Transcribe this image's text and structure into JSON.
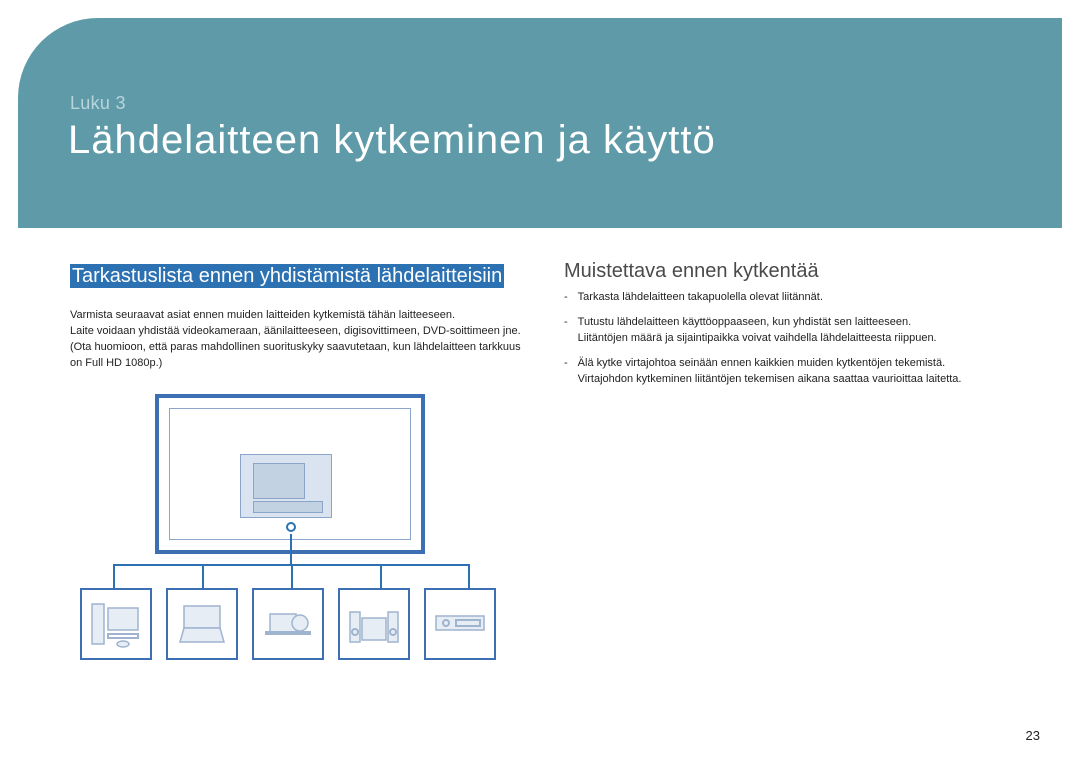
{
  "header": {
    "chapter": "Luku 3",
    "title": "Lähdelaitteen kytkeminen ja käyttö"
  },
  "left": {
    "section_title": "Tarkastuslista ennen yhdistämistä lähdelaitteisiin",
    "intro": "Varmista seuraavat asiat ennen muiden laitteiden kytkemistä tähän laitteeseen.\nLaite voidaan yhdistää videokameraan, äänilaitteeseen, digisovittimeen, DVD-soittimeen jne.\n(Ota huomioon, että paras mahdollinen suorituskyky saavutetaan, kun lähdelaitteen tarkkuus on Full HD 1080p.)"
  },
  "right": {
    "section_title": "Muistettava ennen kytkentää",
    "items": [
      "Tarkasta lähdelaitteen takapuolella olevat liitännät.",
      "Tutustu lähdelaitteen käyttöoppaaseen, kun yhdistät sen laitteeseen.\nLiitäntöjen määrä ja sijaintipaikka voivat vaihdella lähdelaitteesta riippuen.",
      "Älä kytke virtajohtoa seinään ennen kaikkien muiden kytkentöjen tekemistä.\nVirtajohdon kytkeminen liitäntöjen tekemisen aikana saattaa vaurioittaa laitetta."
    ]
  },
  "devices": [
    "desktop-pc",
    "laptop",
    "camcorder",
    "stereo",
    "dvd-player"
  ],
  "page_number": "23"
}
